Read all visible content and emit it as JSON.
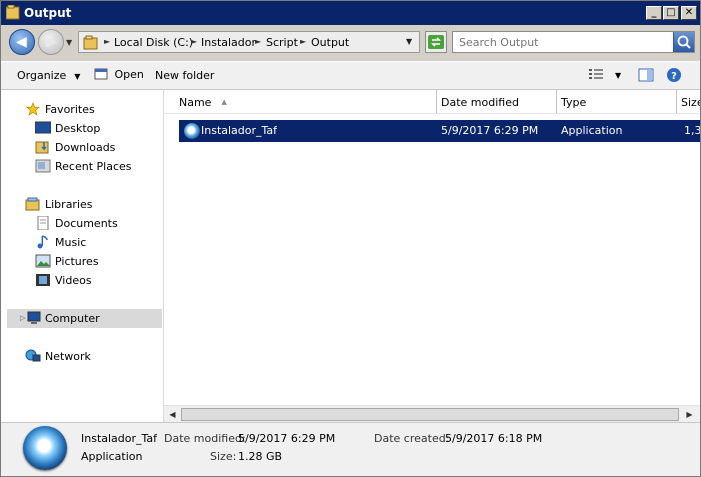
{
  "window": {
    "title": "Output",
    "controls": {
      "minimize": "_",
      "maximize": "□",
      "close": "✕"
    }
  },
  "navigation": {
    "back_icon": "arrow-left-icon",
    "forward_icon": "arrow-right-icon",
    "breadcrumb": [
      "Local Disk (C:)",
      "Instalador",
      "Script",
      "Output"
    ],
    "refresh_icon": "refresh-icon"
  },
  "search": {
    "placeholder": "Search Output",
    "icon": "magnifier-icon"
  },
  "commandbar": {
    "organize": "Organize",
    "open": "Open",
    "new_folder": "New folder",
    "icons": [
      "view-options-icon",
      "preview-pane-icon",
      "help-icon"
    ]
  },
  "sidebar": {
    "groups": [
      {
        "label": "Favorites",
        "icon": "star-icon",
        "items": [
          {
            "label": "Desktop",
            "icon": "desktop-icon"
          },
          {
            "label": "Downloads",
            "icon": "downloads-icon"
          },
          {
            "label": "Recent Places",
            "icon": "recent-places-icon"
          }
        ]
      },
      {
        "label": "Libraries",
        "icon": "libraries-icon",
        "items": [
          {
            "label": "Documents",
            "icon": "documents-icon"
          },
          {
            "label": "Music",
            "icon": "music-icon"
          },
          {
            "label": "Pictures",
            "icon": "pictures-icon"
          },
          {
            "label": "Videos",
            "icon": "videos-icon"
          }
        ]
      },
      {
        "label": "Computer",
        "icon": "computer-icon",
        "items": [],
        "selected": true
      },
      {
        "label": "Network",
        "icon": "network-icon",
        "items": []
      }
    ]
  },
  "filelist": {
    "columns": [
      "Name",
      "Date modified",
      "Type",
      "Size"
    ],
    "rows": [
      {
        "name": "Instalador_Taf",
        "date_modified": "5/9/2017 6:29 PM",
        "type": "Application",
        "size": "1,3"
      }
    ]
  },
  "details": {
    "name": "Instalador_Taf",
    "type": "Application",
    "date_modified_label": "Date modified:",
    "date_modified": "5/9/2017 6:29 PM",
    "date_created_label": "Date created:",
    "date_created": "5/9/2017 6:18 PM",
    "size_label": "Size:",
    "size": "1.28 GB"
  },
  "colors": {
    "title_bar": "#0a246a",
    "selection": "#0a246a",
    "chrome": "#d4d0c8"
  }
}
